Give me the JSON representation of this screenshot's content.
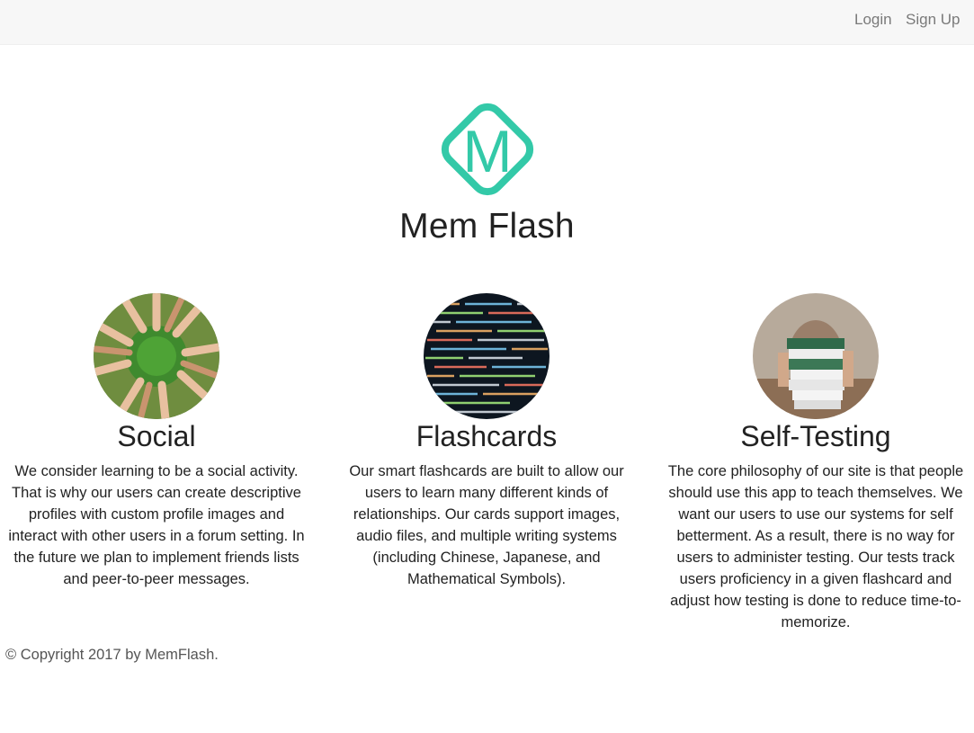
{
  "nav": {
    "login": "Login",
    "signup": "Sign Up"
  },
  "brand": {
    "logo_letter": "M",
    "title": "Mem Flash",
    "accent": "#33c9a8"
  },
  "features": [
    {
      "image": "hands-circle-grass-photo",
      "title": "Social",
      "text": "We consider learning to be a social activity. That is why our users can create descriptive profiles with custom profile images and interact with other users in a forum setting. In the future we plan to implement friends lists and peer-to-peer messages."
    },
    {
      "image": "code-screen-photo",
      "title": "Flashcards",
      "text": "Our smart flashcards are built to allow our users to learn many different kinds of relationships. Our cards support images, audio files, and multiple writing systems (including Chinese, Japanese, and Mathematical Symbols)."
    },
    {
      "image": "book-stack-photo",
      "title": "Self-Testing",
      "text": "The core philosophy of our site is that people should use this app to teach themselves. We want our users to use our systems for self betterment. As a result, there is no way for users to administer testing. Our tests track users proficiency in a given flashcard and adjust how testing is done to reduce time-to-memorize."
    }
  ],
  "footer": {
    "copyright": "© Copyright 2017 by MemFlash."
  }
}
